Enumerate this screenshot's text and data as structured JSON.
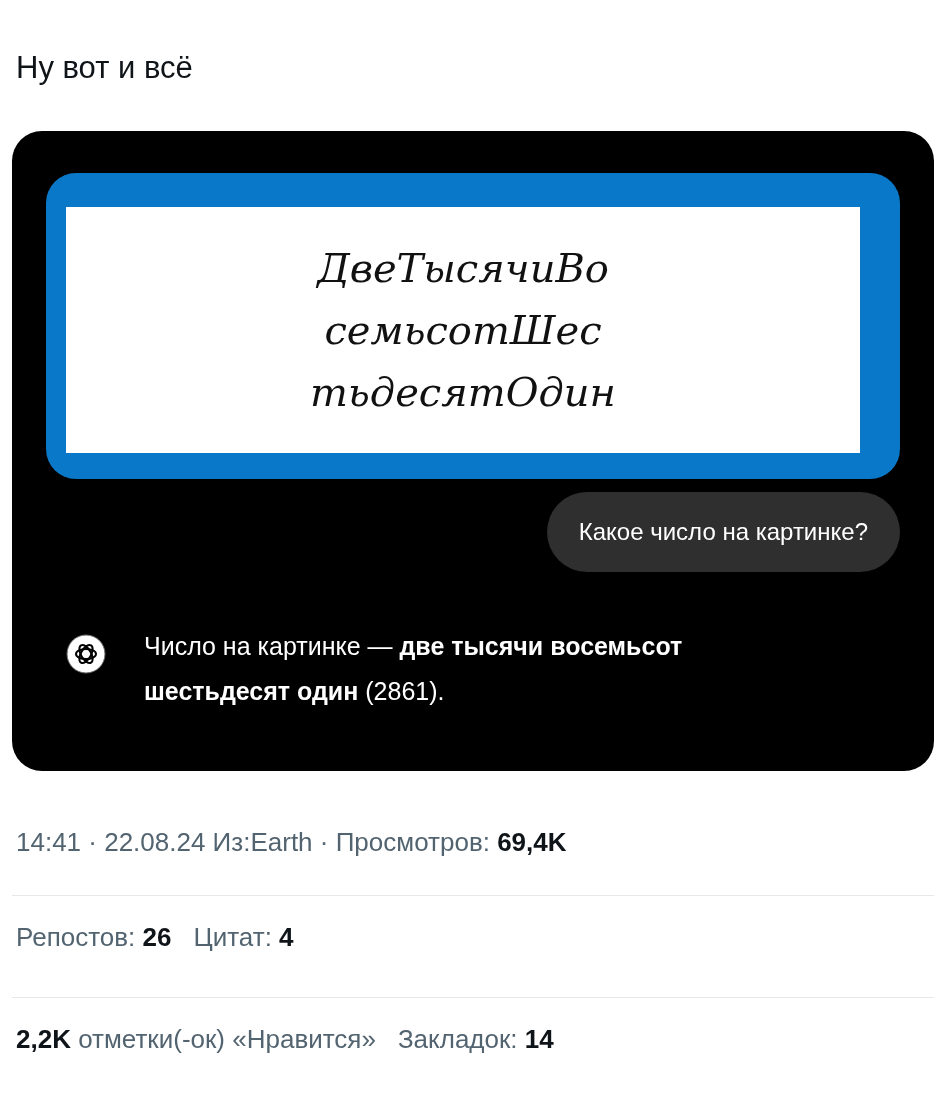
{
  "post": {
    "text": "Ну вот и всё"
  },
  "chat": {
    "handwriting": [
      "ДвеТысячиВо",
      "семьсотШес",
      "тьдесятОдин"
    ],
    "question": "Какое число на картинке?",
    "answer": "Число на картинке — **две тысячи восемьсот шестьдесят один** (2861)."
  },
  "meta": "14:41 · 22.08.24 Из:Earth · Просмотров: **69,4K**",
  "stat_rows": [
    [
      "Репостов: **26**",
      "Цитат: **4**"
    ],
    [
      "**2,2K** отметки(-ок) «Нравится»",
      "Закладок: **14**"
    ]
  ]
}
